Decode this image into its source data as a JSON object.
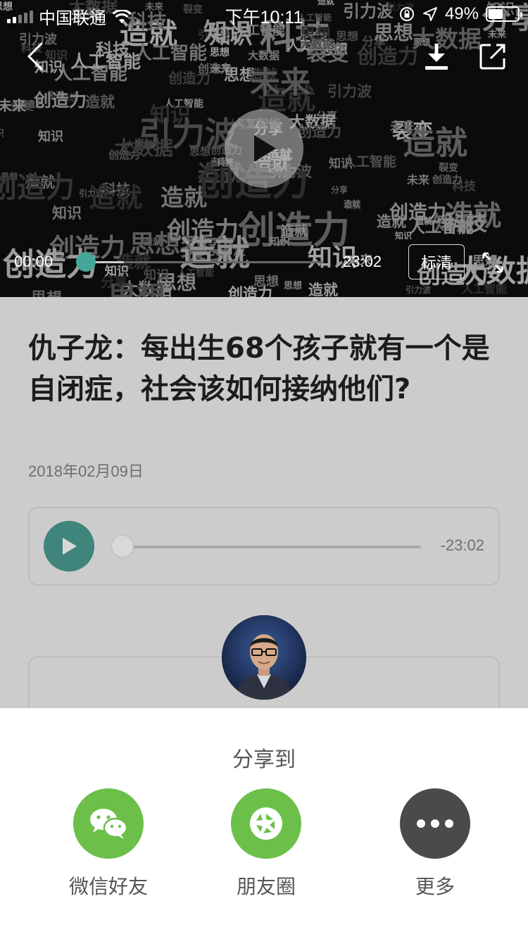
{
  "status_bar": {
    "carrier": "中国联通",
    "time": "下午10:11",
    "battery": "49%",
    "battery_level": 0.49
  },
  "video": {
    "background_words": [
      "思想",
      "造就",
      "大数据",
      "科技",
      "分享",
      "创造力",
      "人工智能",
      "未来",
      "知识",
      "裂变",
      "引力波"
    ],
    "current_time": "00:00",
    "duration": "23:02",
    "quality_label": "标清",
    "progress": 0.0
  },
  "article": {
    "title": "仇子龙：每出生68个孩子就有一个是自闭症，社会该如何接纳他们?",
    "date": "2018年02月09日"
  },
  "audio": {
    "remaining": "-23:02",
    "progress": 0.0
  },
  "share": {
    "title": "分享到",
    "options": [
      {
        "label": "微信好友",
        "icon": "wechat-icon",
        "color": "#6cc04a"
      },
      {
        "label": "朋友圈",
        "icon": "moments-icon",
        "color": "#6cc04a"
      },
      {
        "label": "更多",
        "icon": "more-icon",
        "color": "#4a4a4a"
      }
    ]
  },
  "colors": {
    "accent": "#47a69b",
    "overlay_dim": "#cccccc",
    "wechat_green": "#6cc04a"
  }
}
